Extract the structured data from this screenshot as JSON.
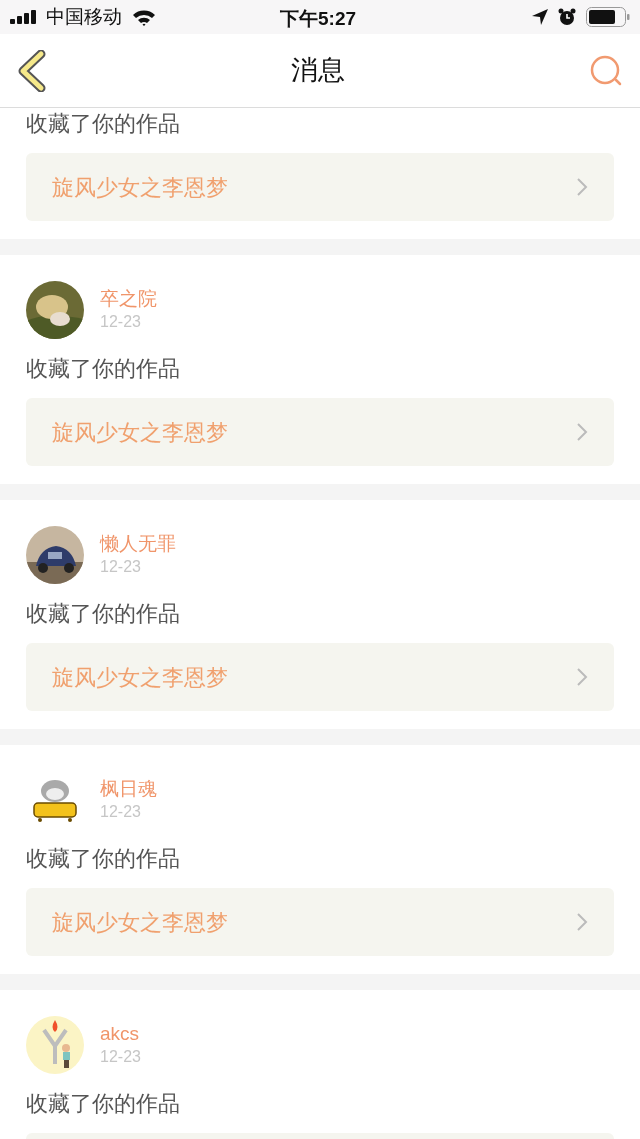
{
  "status_bar": {
    "carrier": "中国移动",
    "time": "下午5:27"
  },
  "nav": {
    "title": "消息"
  },
  "messages": [
    {
      "action": "收藏了你的作品",
      "work": "旋风少女之李恩梦"
    },
    {
      "user": "卒之院",
      "date": "12-23",
      "action": "收藏了你的作品",
      "work": "旋风少女之李恩梦"
    },
    {
      "user": "懒人无罪",
      "date": "12-23",
      "action": "收藏了你的作品",
      "work": "旋风少女之李恩梦"
    },
    {
      "user": "枫日魂",
      "date": "12-23",
      "action": "收藏了你的作品",
      "work": "旋风少女之李恩梦"
    },
    {
      "user": "akcs",
      "date": "12-23",
      "action": "收藏了你的作品"
    }
  ]
}
